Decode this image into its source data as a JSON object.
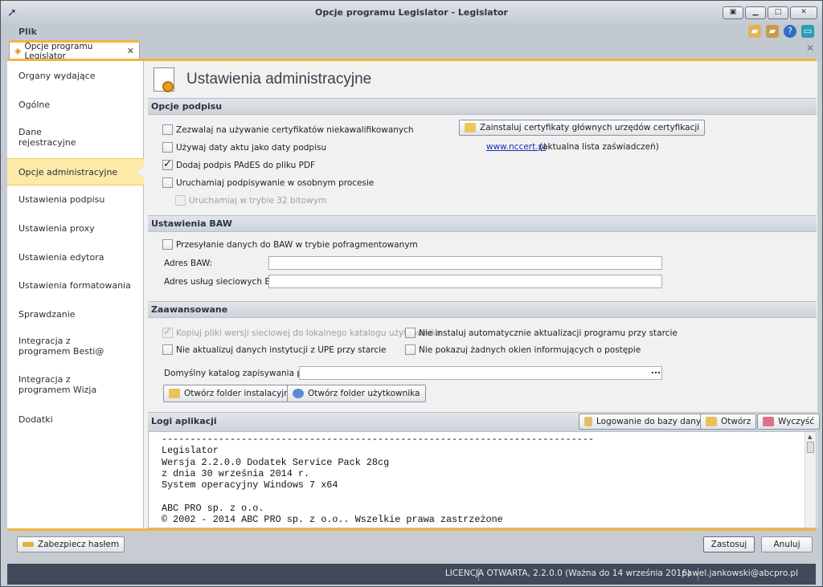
{
  "window": {
    "title": "Opcje programu Legislator - Legislator"
  },
  "menu": {
    "file": "Plik"
  },
  "tabs": {
    "active_label": "Opcje programu Legislator"
  },
  "sidebar": {
    "items": [
      {
        "label": "Organy wydające"
      },
      {
        "label": "Ogólne"
      },
      {
        "label": "Dane rejestracyjne"
      },
      {
        "label": "Opcje administracyjne",
        "active": true
      },
      {
        "label": "Ustawienia podpisu"
      },
      {
        "label": "Ustawienia proxy"
      },
      {
        "label": "Ustawienia edytora"
      },
      {
        "label": "Ustawienia formatowania"
      },
      {
        "label": "Sprawdzanie"
      },
      {
        "label": "Integracja z programem Besti@"
      },
      {
        "label": "Integracja z programem Wizja"
      },
      {
        "label": "Dodatki"
      }
    ]
  },
  "content": {
    "title": "Ustawienia administracyjne",
    "signature": {
      "header": "Opcje podpisu",
      "allow_unqualified": {
        "label": "Zezwalaj na używanie certyfikatów niekawalifikowanych",
        "checked": false
      },
      "use_act_date": {
        "label": "Używaj daty aktu jako daty podpisu",
        "checked": false
      },
      "add_pades": {
        "label": "Dodaj podpis PAdES do pliku PDF",
        "checked": true
      },
      "separate_process": {
        "label": "Uruchamiaj podpisywanie w osobnym procesie",
        "checked": false
      },
      "run_32bit": {
        "label": "Uruchamiaj w trybie 32 bitowym",
        "checked": false,
        "disabled": true
      },
      "install_certs_button": "Zainstaluj certyfikaty głównych urzędów certyfikacji",
      "nccert_link": "www.nccert.pl",
      "nccert_note": "(aktualna lista zaświadczeń)"
    },
    "baw": {
      "header": "Ustawienia BAW",
      "fragmented": {
        "label": "Przesyłanie danych do BAW w trybie pofragmentowanym",
        "checked": false
      },
      "address_label": "Adres BAW:",
      "address_value": "",
      "services_label": "Adres usług sieciowych BAW:",
      "services_value": ""
    },
    "advanced": {
      "header": "Zaawansowane",
      "copy_network": {
        "label": "Kopiuj pliki wersji sieciowej do lokalnego katalogu użytkownika",
        "checked": true,
        "disabled": true
      },
      "no_auto_update": {
        "label": "Nie instaluj automatycznie aktualizacji programu przy starcie",
        "checked": false
      },
      "no_upe_update": {
        "label": "Nie aktualizuj danych instytucji z UPE przy starcie",
        "checked": false
      },
      "no_progress": {
        "label": "Nie pokazuj żadnych okien informujących o postępie",
        "checked": false
      },
      "default_dir_label": "Domyślny katalog zapisywania plików :",
      "default_dir_value": "",
      "browse_label": "...",
      "open_install_button": "Otwórz folder instalacyjny",
      "open_user_button": "Otwórz folder użytkownika"
    },
    "logs": {
      "header": "Logi aplikacji",
      "db_logging_button": "Logowanie do bazy danych",
      "open_button": "Otwórz",
      "clear_button": "Wyczyść",
      "text": "----------------------------------------------------------------------------\nLegislator\nWersja 2.2.0.0 Dodatek Service Pack 28cg\nz dnia 30 września 2014 r.\nSystem operacyjny Windows 7 x64\n\nABC PRO sp. z o.o.\n© 2002 - 2014 ABC PRO sp. z o.o.. Wszelkie prawa zastrzeżone\n=============================================================================="
    }
  },
  "footer": {
    "protect_button": "Zabezpiecz hasłem",
    "apply_button": "Zastosuj",
    "cancel_button": "Anuluj"
  },
  "status": {
    "license": "LICENCJA OTWARTA, 2.2.0.0 (Ważna do 14 września 2016)",
    "user": "pawel.jankowski@abcpro.pl"
  }
}
